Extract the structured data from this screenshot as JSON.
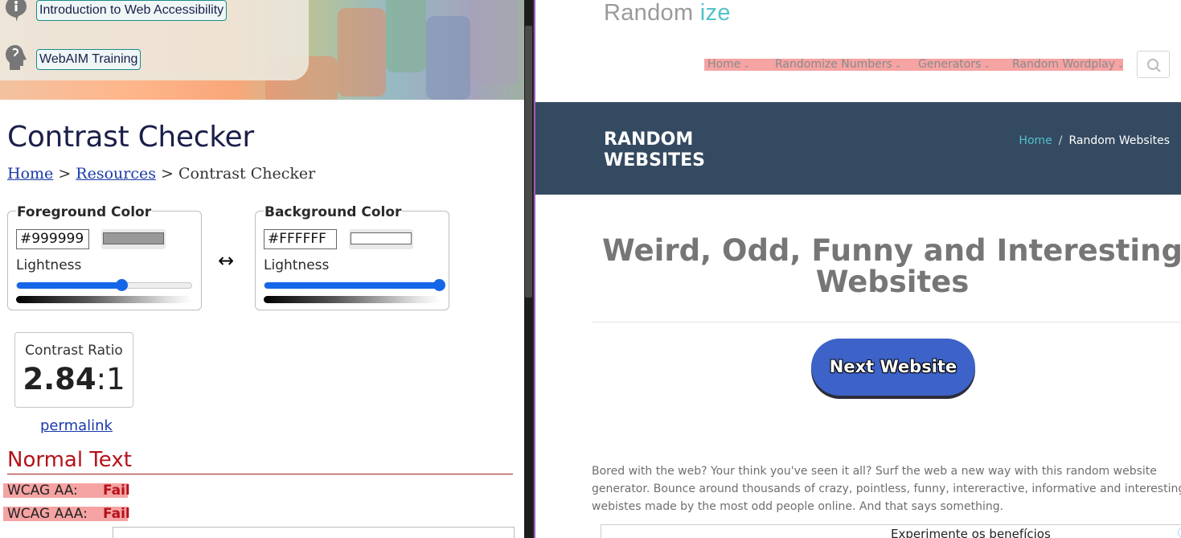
{
  "left": {
    "banner_links": [
      {
        "label": "Introduction to Web Accessibility",
        "icon": "info-icon"
      },
      {
        "label": "WebAIM Training",
        "icon": "head-icon"
      }
    ],
    "title": "Contrast Checker",
    "breadcrumb": {
      "home": "Home",
      "sep": ">",
      "resources": "Resources",
      "current": "Contrast Checker"
    },
    "foreground": {
      "legend": "Foreground Color",
      "hex": "#999999",
      "swatch": "#999999",
      "lightness_label": "Lightness",
      "lightness": 0.6
    },
    "background": {
      "legend": "Background Color",
      "hex": "#FFFFFF",
      "swatch": "#FFFFFF",
      "lightness_label": "Lightness",
      "lightness": 1.0
    },
    "swap_glyph": "↔",
    "contrast": {
      "label": "Contrast Ratio",
      "value": "2.84",
      "suffix": ":1"
    },
    "permalink": "permalink",
    "normal_text": {
      "heading": "Normal Text",
      "rows": [
        {
          "label": "WCAG AA:",
          "result": "Fail"
        },
        {
          "label": "WCAG AAA:",
          "result": "Fail"
        }
      ]
    }
  },
  "right": {
    "logo": {
      "part1": "Random ",
      "part2": "ize"
    },
    "nav": [
      {
        "label": "Home"
      },
      {
        "label": "Randomize Numbers"
      },
      {
        "label": "Generators"
      },
      {
        "label": "Random Wordplay"
      }
    ],
    "hero": {
      "title": "RANDOM WEBSITES",
      "crumb_home": "Home",
      "crumb_sep": "/",
      "crumb_current": "Random Websites"
    },
    "heading": "Weird, Odd, Funny and Interesting Websites",
    "next_button": "Next Website",
    "paragraph": "Bored with the web? Your think you've seen it all? Surf the web a new way with this random website generator. Bounce around thousands of crazy, pointless, funny, intereractive, informative and interesting webistes made by the most odd people online. And that says something.",
    "ad_text": "Experimente os benefícios",
    "ad_info": "ⓘ ✕"
  },
  "colors": {
    "accent_teal": "#52c1c9",
    "hero_bg": "#344a61",
    "button_blue": "#3d62c8",
    "fail_red": "#b5121b",
    "slider_blue": "#1565e8"
  }
}
